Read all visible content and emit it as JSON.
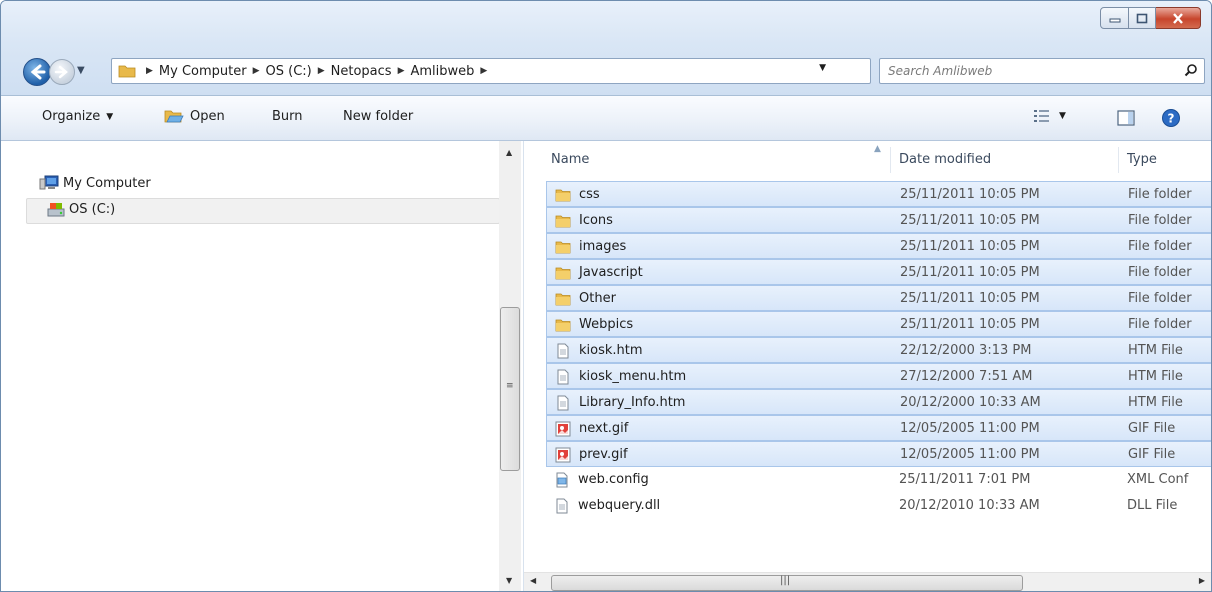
{
  "address": {
    "crumbs": [
      "My Computer",
      "OS (C:)",
      "Netopacs",
      "Amlibweb"
    ]
  },
  "search": {
    "placeholder": "Search Amlibweb"
  },
  "toolbar": {
    "organize": "Organize",
    "open": "Open",
    "burn": "Burn",
    "new_folder": "New folder"
  },
  "nav": {
    "items": [
      {
        "label": "My Computer",
        "icon": "computer-icon"
      },
      {
        "label": "OS (C:)",
        "icon": "drive-icon",
        "selected": true
      }
    ]
  },
  "columns": {
    "name": "Name",
    "date": "Date modified",
    "type": "Type"
  },
  "files": [
    {
      "name": "css",
      "date": "25/11/2011 10:05 PM",
      "type": "File folder",
      "icon": "folder",
      "selected": true
    },
    {
      "name": "Icons",
      "date": "25/11/2011 10:05 PM",
      "type": "File folder",
      "icon": "folder",
      "selected": true
    },
    {
      "name": "images",
      "date": "25/11/2011 10:05 PM",
      "type": "File folder",
      "icon": "folder",
      "selected": true
    },
    {
      "name": "Javascript",
      "date": "25/11/2011 10:05 PM",
      "type": "File folder",
      "icon": "folder",
      "selected": true
    },
    {
      "name": "Other",
      "date": "25/11/2011 10:05 PM",
      "type": "File folder",
      "icon": "folder",
      "selected": true
    },
    {
      "name": "Webpics",
      "date": "25/11/2011 10:05 PM",
      "type": "File folder",
      "icon": "folder",
      "selected": true
    },
    {
      "name": "kiosk.htm",
      "date": "22/12/2000 3:13 PM",
      "type": "HTM File",
      "icon": "document",
      "selected": true
    },
    {
      "name": "kiosk_menu.htm",
      "date": "27/12/2000 7:51 AM",
      "type": "HTM File",
      "icon": "document",
      "selected": true
    },
    {
      "name": "Library_Info.htm",
      "date": "20/12/2000 10:33 AM",
      "type": "HTM File",
      "icon": "document",
      "selected": true
    },
    {
      "name": "next.gif",
      "date": "12/05/2005 11:00 PM",
      "type": "GIF File",
      "icon": "image",
      "selected": true
    },
    {
      "name": "prev.gif",
      "date": "12/05/2005 11:00 PM",
      "type": "GIF File",
      "icon": "image",
      "selected": true
    },
    {
      "name": "web.config",
      "date": "25/11/2011 7:01 PM",
      "type": "XML Conf",
      "icon": "config",
      "selected": false
    },
    {
      "name": "webquery.dll",
      "date": "20/12/2010 10:33 AM",
      "type": "DLL File",
      "icon": "document",
      "selected": false
    }
  ],
  "colors": {
    "selection_fill": "#d9e8fb",
    "selection_border": "#a9c6ea",
    "folder": "#e8b94a"
  }
}
